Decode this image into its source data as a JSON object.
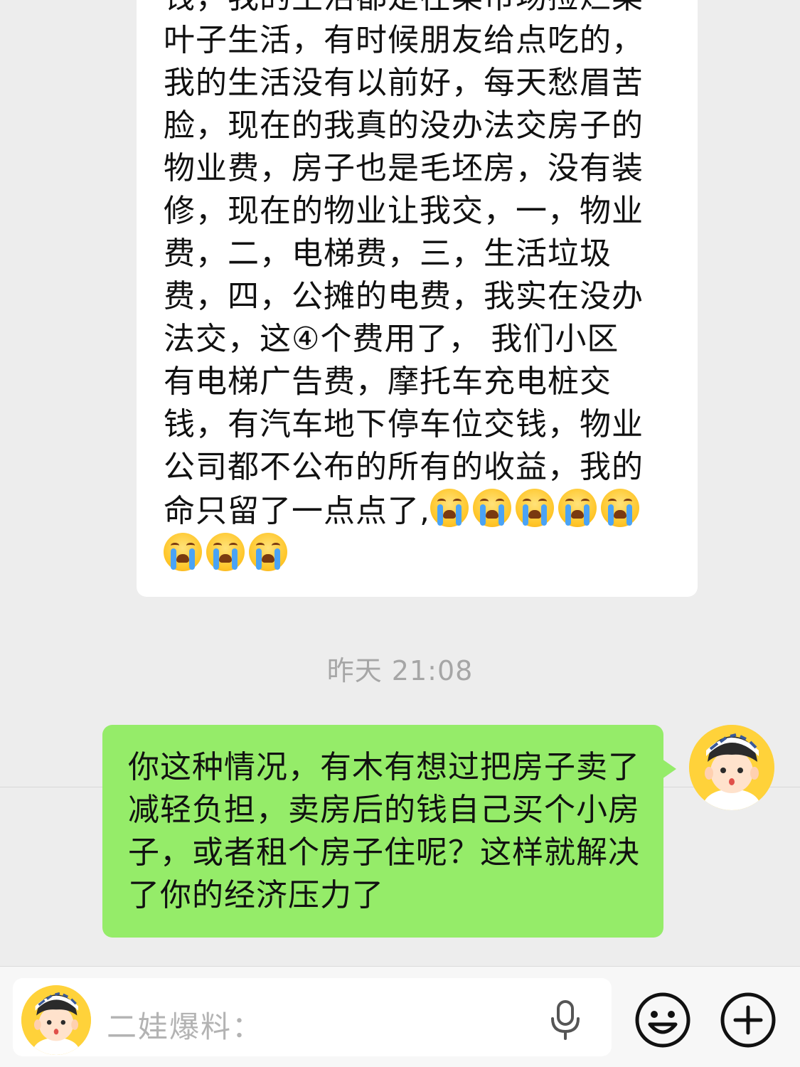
{
  "incoming_message": {
    "lines": [
      "钱，我的生活都是在菜市场捡烂菜",
      "叶子生活，有时候朋友给点吃的，",
      "我的生活没有以前好，每天愁眉苦",
      "脸，现在的我真的没办法交房子的",
      "物业费，房子也是毛坯房，没有装",
      "修，现在的物业让我交，一，物业",
      "费，二，电梯费，三，生活垃圾",
      "费，四，公摊的电费，我实在没办",
      "法交，这④个费用了， 我们小区",
      "有电梯广告费，摩托车充电桩交",
      "钱，有汽车地下停车位交钱，物业",
      "公司都不公布的所有的收益，我的",
      "命只留了一点点了,"
    ],
    "crying_emoji_count": 8,
    "emoji_icon": "loudly-crying-face-icon"
  },
  "timestamp": "昨天 21:08",
  "outgoing_message": {
    "text": "你这种情况，有木有想过把房子卖了减轻负担，卖房后的钱自己买个小房子，或者租个房子住呢？这样就解决了你的经济压力了"
  },
  "input_bar": {
    "placeholder": "二娃爆料：",
    "mic_icon": "microphone-icon",
    "emoji_icon": "smiley-face-icon",
    "plus_icon": "plus-circle-icon"
  },
  "colors": {
    "background": "#ededed",
    "incoming_bubble": "#ffffff",
    "outgoing_bubble": "#95ec69",
    "avatar_bg": "#ffd23a"
  }
}
